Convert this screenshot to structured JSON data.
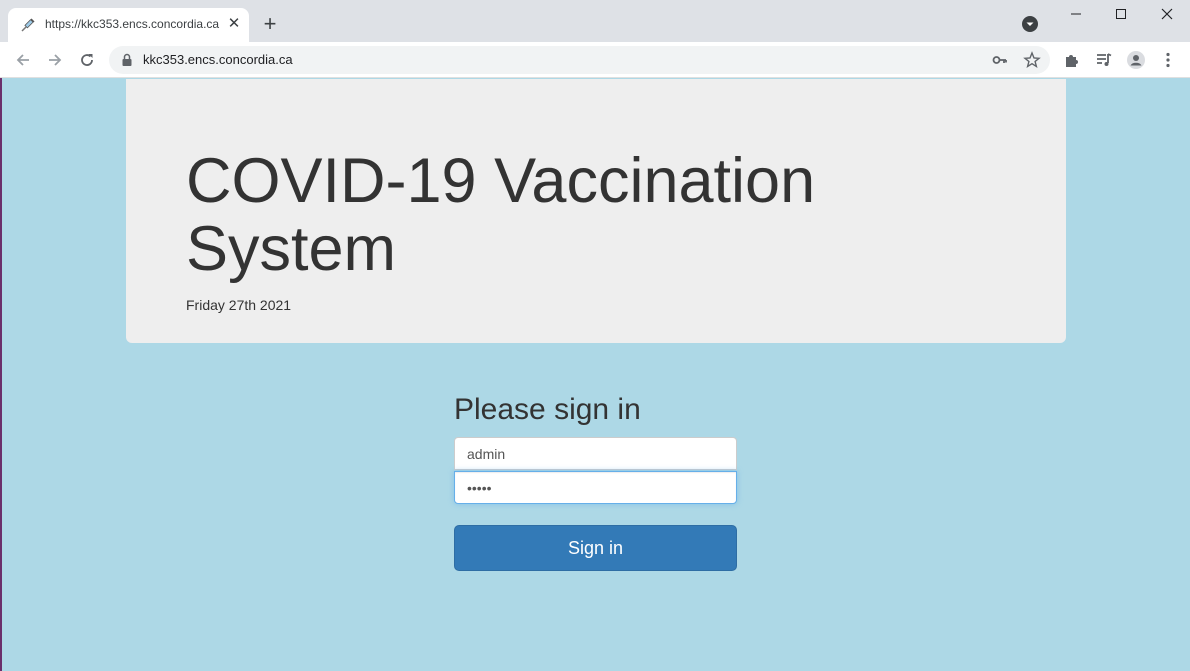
{
  "browser": {
    "tab": {
      "title": "https://kkc353.encs.concordia.ca",
      "favicon": "syringe-icon",
      "close_icon": "close-icon"
    },
    "new_tab_icon": "plus-icon",
    "tab_search_icon": "chevron-down-circle-icon",
    "window_controls": [
      "minimize-icon",
      "maximize-icon",
      "close-icon"
    ],
    "nav": [
      "back-arrow-icon",
      "forward-arrow-icon",
      "reload-icon"
    ],
    "address_bar": {
      "lock_icon": "lock-icon",
      "url": "kkc353.encs.concordia.ca",
      "icons": [
        "key-icon",
        "star-icon"
      ]
    },
    "toolbar_icons": [
      "puzzle-icon",
      "media-icon",
      "profile-icon",
      "kebab-menu-icon"
    ]
  },
  "page": {
    "title": "COVID-19 Vaccination System",
    "date": "Friday 27th 2021",
    "signin": {
      "heading": "Please sign in",
      "username_value": "admin",
      "password_value": "•••••",
      "submit_label": "Sign in"
    }
  },
  "colors": {
    "page_background": "#add8e6",
    "jumbotron_background": "#eeeeee",
    "primary_button": "#337ab7"
  }
}
